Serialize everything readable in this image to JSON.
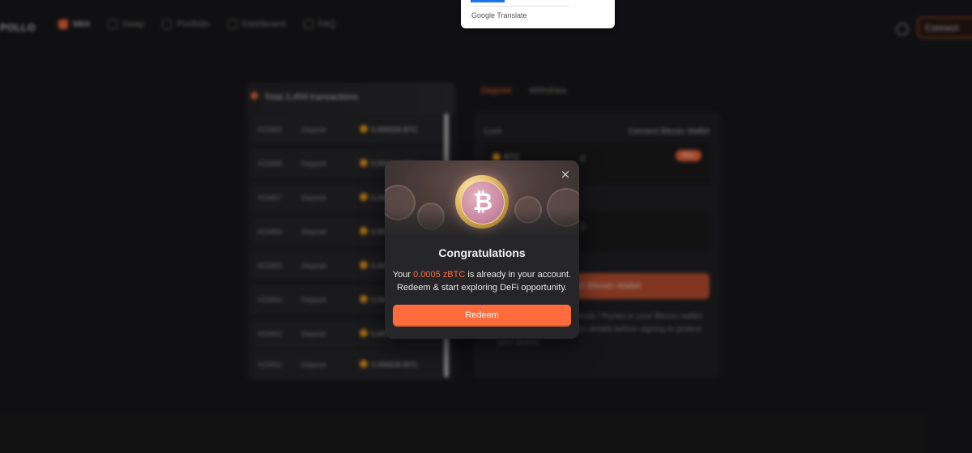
{
  "google_translate": {
    "label": "Google Translate"
  },
  "header": {
    "brand": "POLLO",
    "nav": [
      {
        "label": "Mint",
        "active": true
      },
      {
        "label": "Swap",
        "active": false
      },
      {
        "label": "Portfolio",
        "active": false
      },
      {
        "label": "Dashboard",
        "active": false
      },
      {
        "label": "FAQ",
        "active": false
      }
    ],
    "connect_label": "Connect"
  },
  "transactions": {
    "header": "Total 3,459 transactions",
    "rows": [
      {
        "id": "#23459",
        "type": "Deposit",
        "amount": "0.000026 BTC"
      },
      {
        "id": "#23458",
        "type": "Deposit",
        "amount": "0.000026 BTC"
      },
      {
        "id": "#23457",
        "type": "Deposit",
        "amount": "0.000"
      },
      {
        "id": "#23456",
        "type": "Deposit",
        "amount": "0.000"
      },
      {
        "id": "#23455",
        "type": "Deposit",
        "amount": "0.000"
      },
      {
        "id": "#23454",
        "type": "Deposit",
        "amount": "0.000"
      },
      {
        "id": "#23453",
        "type": "Deposit",
        "amount": "0.000"
      },
      {
        "id": "#23452",
        "type": "Deposit",
        "amount": "0.000026 BTC"
      }
    ]
  },
  "deposit_panel": {
    "tabs": [
      "Deposit",
      "Withdraw"
    ],
    "lock_label": "Lock",
    "connect_wallet_text": "Connect Bitcoin Wallet",
    "input_value": "0",
    "max_label": "Max",
    "btc_label": "BTC",
    "connect_button": "Connect Bitcoin Wallet",
    "note": "safe: avoid storing Ordinals / Runes in your Bitcoin wallet. Always verify transaction details before signing to protect your assets."
  },
  "modal": {
    "title": "Congratulations",
    "msg_prefix": "Your ",
    "msg_amount": "0.0005 zBTC",
    "msg_suffix": " is already in your account.",
    "msg_line2": "Redeem & start exploring DeFi opportunity.",
    "redeem_label": "Redeem",
    "close_glyph": "×",
    "coin_glyph": "₿"
  },
  "colors": {
    "accent": "#ff6b3d",
    "modal_bg": "#262628",
    "page_bg": "#1a1a1c"
  }
}
